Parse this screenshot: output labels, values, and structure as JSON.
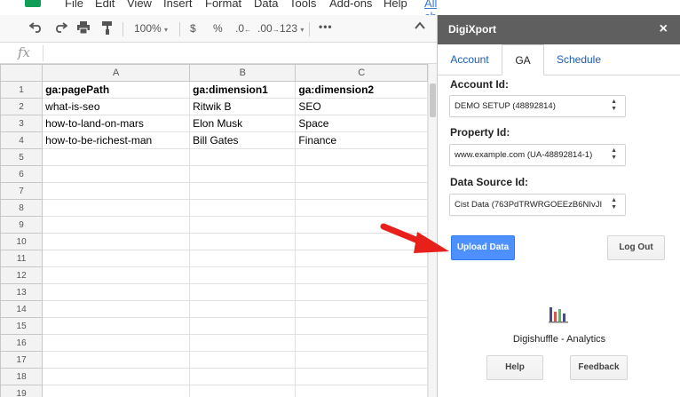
{
  "menubar": {
    "items": [
      "File",
      "Edit",
      "View",
      "Insert",
      "Format",
      "Data",
      "Tools",
      "Add-ons",
      "Help"
    ],
    "all_changes": "All changes"
  },
  "toolbar": {
    "zoom": "100%",
    "currency": "$",
    "percent": "%",
    "dec_less": ".0",
    "dec_more": ".00",
    "format_more": "123"
  },
  "formula": {
    "fx": "fx"
  },
  "sheet": {
    "columns": [
      "A",
      "B",
      "C"
    ],
    "rows": [
      {
        "n": "1",
        "cells": [
          "ga:pagePath",
          "ga:dimension1",
          "ga:dimension2"
        ],
        "header": true
      },
      {
        "n": "2",
        "cells": [
          "what-is-seo",
          "Ritwik B",
          "SEO"
        ]
      },
      {
        "n": "3",
        "cells": [
          "how-to-land-on-mars",
          "Elon Musk",
          "Space"
        ]
      },
      {
        "n": "4",
        "cells": [
          "how-to-be-richest-man",
          "Bill Gates",
          "Finance"
        ]
      },
      {
        "n": "5",
        "cells": [
          "",
          "",
          ""
        ]
      },
      {
        "n": "6",
        "cells": [
          "",
          "",
          ""
        ]
      },
      {
        "n": "7",
        "cells": [
          "",
          "",
          ""
        ]
      },
      {
        "n": "8",
        "cells": [
          "",
          "",
          ""
        ]
      },
      {
        "n": "9",
        "cells": [
          "",
          "",
          ""
        ]
      },
      {
        "n": "10",
        "cells": [
          "",
          "",
          ""
        ]
      },
      {
        "n": "11",
        "cells": [
          "",
          "",
          ""
        ]
      },
      {
        "n": "12",
        "cells": [
          "",
          "",
          ""
        ]
      },
      {
        "n": "13",
        "cells": [
          "",
          "",
          ""
        ]
      },
      {
        "n": "14",
        "cells": [
          "",
          "",
          ""
        ]
      },
      {
        "n": "15",
        "cells": [
          "",
          "",
          ""
        ]
      },
      {
        "n": "16",
        "cells": [
          "",
          "",
          ""
        ]
      },
      {
        "n": "17",
        "cells": [
          "",
          "",
          ""
        ]
      },
      {
        "n": "18",
        "cells": [
          "",
          "",
          ""
        ]
      },
      {
        "n": "19",
        "cells": [
          "",
          "",
          ""
        ]
      }
    ]
  },
  "sidebar": {
    "title": "DigiXport",
    "close": "×",
    "tabs": [
      "Account",
      "GA",
      "Schedule"
    ],
    "active_tab": "GA",
    "account_label": "Account Id:",
    "account_value": "DEMO  SETUP (48892814)",
    "property_label": "Property Id:",
    "property_value": "www.example.com (UA-48892814-1)",
    "datasource_label": "Data Source Id:",
    "datasource_value": "Cist Data (763PdTRWRGOEEzB6NIvJI",
    "upload_button": "Upload Data",
    "logout_button": "Log Out",
    "brand": "Digishuffle - Analytics",
    "help_button": "Help",
    "feedback_button": "Feedback"
  },
  "colors": {
    "sidebar_header": "#5f5f5f",
    "primary_button": "#4d90fe",
    "tab_link": "#1f5cad",
    "arrow": "#e8201c",
    "sheets_green": "#0f9d58"
  },
  "icons": [
    "undo-icon",
    "redo-icon",
    "print-icon",
    "paint-format-icon",
    "more-icon",
    "collapse-icon",
    "close-icon",
    "analytics-logo-icon",
    "pointer-arrow-icon",
    "dropdown-arrows-icon"
  ]
}
